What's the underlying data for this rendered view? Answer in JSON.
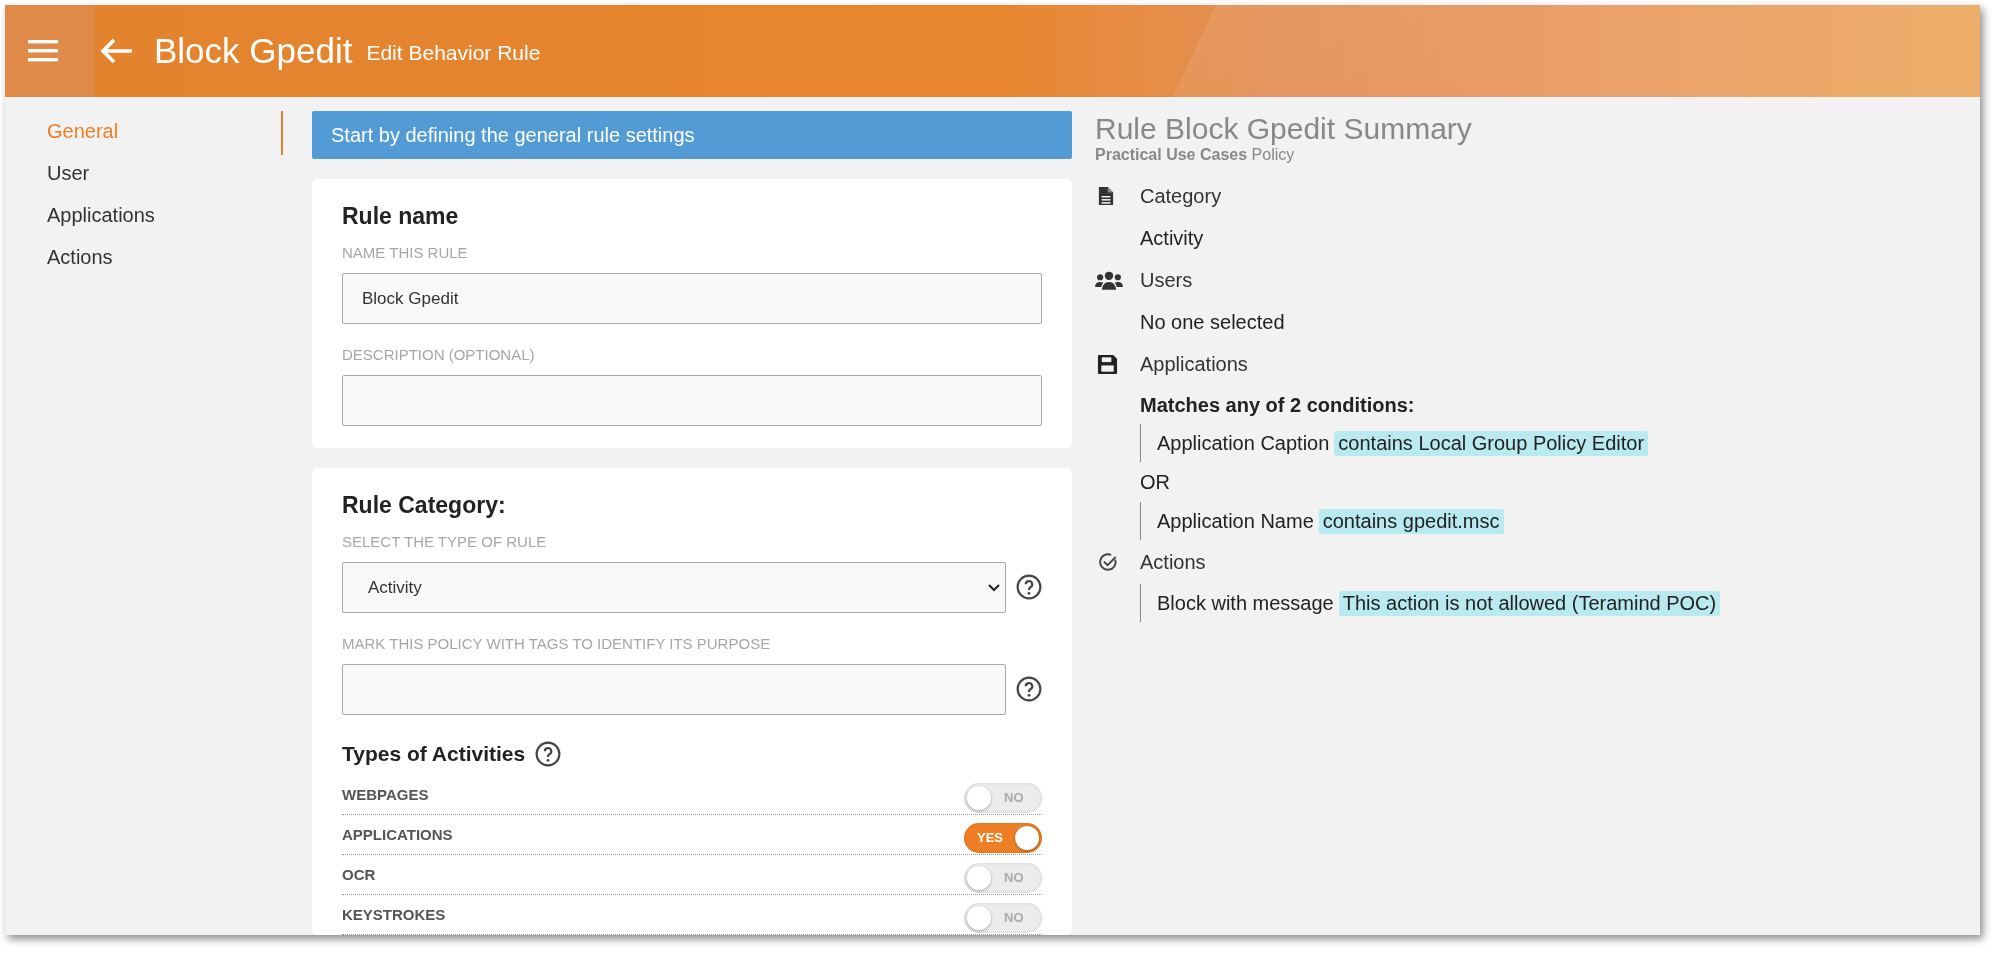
{
  "header": {
    "title": "Block Gpedit",
    "subtitle": "Edit Behavior Rule"
  },
  "sidebar": {
    "items": [
      {
        "label": "General",
        "selected": true
      },
      {
        "label": "User",
        "selected": false
      },
      {
        "label": "Applications",
        "selected": false
      },
      {
        "label": "Actions",
        "selected": false
      }
    ]
  },
  "banner": "Start by defining the general rule settings",
  "rule_name_card": {
    "title": "Rule name",
    "fields": [
      {
        "label": "NAME THIS RULE",
        "value": "Block Gpedit"
      },
      {
        "label": "DESCRIPTION (OPTIONAL)"
      }
    ]
  },
  "category_card": {
    "title": "Rule Category:",
    "type_label": "SELECT THE TYPE OF RULE",
    "type_value": "Activity",
    "tags_label": "MARK THIS POLICY WITH TAGS TO IDENTIFY ITS PURPOSE",
    "activities_title": "Types of Activities",
    "activities": [
      {
        "label": "WEBPAGES",
        "on": false,
        "toggle_text": "NO"
      },
      {
        "label": "APPLICATIONS",
        "on": true,
        "toggle_text": "YES"
      },
      {
        "label": "OCR",
        "on": false,
        "toggle_text": "NO"
      },
      {
        "label": "KEYSTROKES",
        "on": false,
        "toggle_text": "NO"
      }
    ]
  },
  "summary": {
    "title": "Rule Block Gpedit Summary",
    "subtitle": "**Practical Use Cases** Policy",
    "sections": [
      {
        "kind": "document",
        "heading": "Category",
        "lines": [
          {
            "kind": "value",
            "text": "Activity"
          }
        ]
      },
      {
        "kind": "users",
        "heading": "Users",
        "lines": [
          {
            "kind": "value",
            "text": "No one selected"
          }
        ]
      },
      {
        "kind": "floppy",
        "heading": "Applications",
        "lines": [
          {
            "kind": "match",
            "text": "Matches any of 2 conditions:"
          },
          {
            "kind": "condition",
            "text": "Application Caption",
            "highlight": "contains Local Group Policy Editor"
          },
          {
            "kind": "or",
            "text": "OR"
          },
          {
            "kind": "condition",
            "text": "Application Name",
            "highlight": "contains gpedit.msc"
          }
        ]
      },
      {
        "kind": "check",
        "heading": "Actions",
        "lines": [
          {
            "kind": "condition",
            "text": "Block with message",
            "highlight": "This action is not allowed (Teramind POC)"
          }
        ]
      }
    ]
  }
}
